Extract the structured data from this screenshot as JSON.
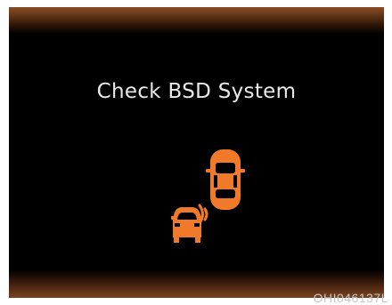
{
  "display": {
    "message": "Check BSD System",
    "icon": "blind-spot-detection-warning-icon",
    "icon_color": "#f07a2a",
    "background_color": "#000000",
    "band_color": "#7a4421"
  },
  "watermark": "OHI046137L"
}
